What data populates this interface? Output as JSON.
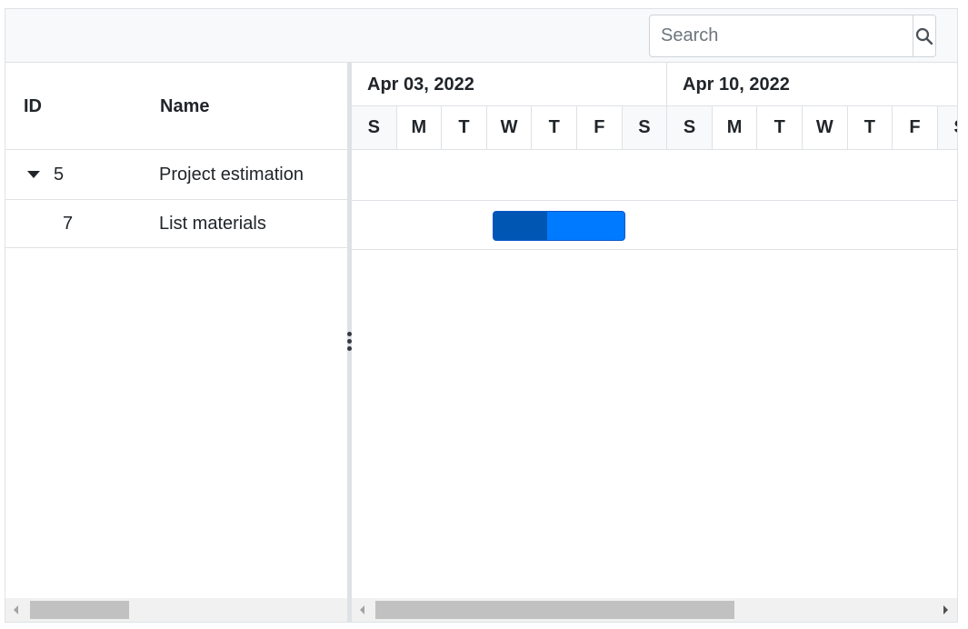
{
  "toolbar": {
    "search_placeholder": "Search",
    "search_icon": "search-icon"
  },
  "grid": {
    "columns": [
      {
        "label": "ID"
      },
      {
        "label": "Name"
      }
    ],
    "rows": [
      {
        "id": "5",
        "name": "Project estimation",
        "expanded": true
      },
      {
        "id": "7",
        "name": "List materials"
      }
    ]
  },
  "timeline": {
    "weeks": [
      "Apr 03, 2022",
      "Apr 10, 2022"
    ],
    "days": [
      "S",
      "M",
      "T",
      "W",
      "T",
      "F",
      "S",
      "S",
      "M",
      "T",
      "W",
      "T",
      "F",
      "S"
    ]
  },
  "colors": {
    "taskbar": "#007bff",
    "progress": "#0056b3",
    "weekend": "#f8f9fa"
  }
}
